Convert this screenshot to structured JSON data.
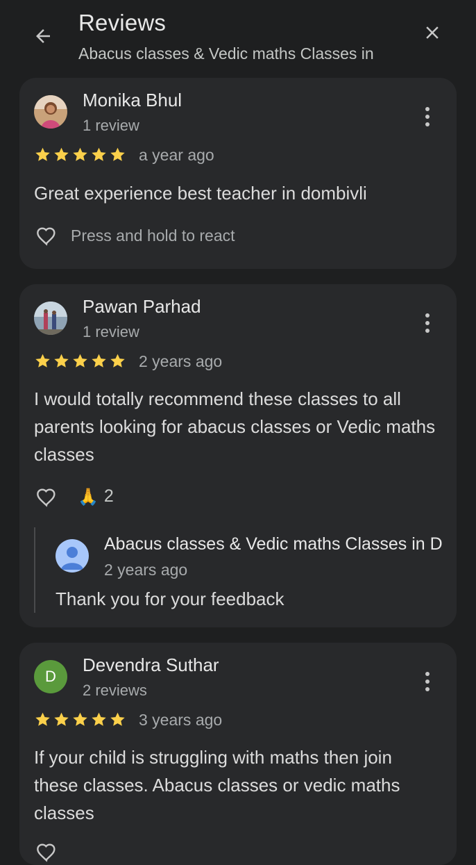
{
  "header": {
    "title": "Reviews",
    "subtitle": "Abacus classes & Vedic maths Classes in",
    "back_icon": "arrow-back-icon",
    "close_icon": "close-icon"
  },
  "colors": {
    "background": "#1e1f20",
    "card": "#28292b",
    "star": "#fbd04b",
    "owner_avatar": "#a8c7fa",
    "letter_avatar": "#5a9a3c"
  },
  "reviews": [
    {
      "name": "Monika Bhul",
      "count": "1 review",
      "rating": 5,
      "time": "a year ago",
      "text": "Great experience best teacher in dombivli",
      "react_hint": "Press and hold to react"
    },
    {
      "name": "Pawan Parhad",
      "count": "1 review",
      "rating": 5,
      "time": "2 years ago",
      "text": "I would totally recommend these classes to all parents looking for abacus classes or Vedic maths classes",
      "reaction_emoji": "🙏",
      "reaction_count": "2",
      "owner_reply": {
        "name": "Abacus classes & Vedic maths Classes in D",
        "time": "2 years ago",
        "text": "Thank you for your feedback"
      }
    },
    {
      "name": "Devendra Suthar",
      "avatar_letter": "D",
      "count": "2 reviews",
      "rating": 5,
      "time": "3 years ago",
      "text": "If your child is struggling with maths then join these classes. Abacus classes or vedic maths classes"
    }
  ]
}
